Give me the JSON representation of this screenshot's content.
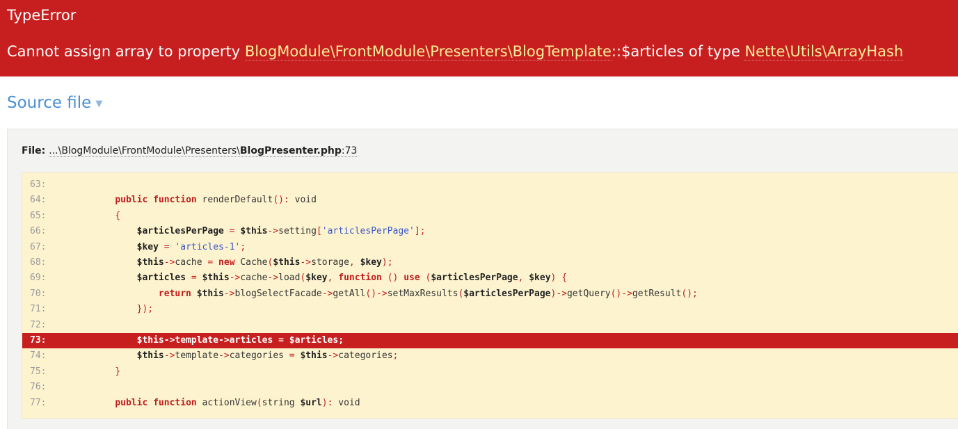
{
  "header": {
    "type": "TypeError",
    "message": {
      "prefix": "Cannot assign array to property",
      "class": "BlogModule\\FrontModule\\Presenters\\BlogTemplate",
      "sep": "::",
      "property": "$articles of type",
      "type": "Nette\\Utils\\ArrayHash"
    }
  },
  "section": {
    "title": "Source file",
    "toggle_icon": "triangle-down-icon"
  },
  "file": {
    "label": "File:",
    "path": "...\\BlogModule\\FrontModule\\Presenters\\",
    "name": "BlogPresenter.php",
    "line": ":73"
  },
  "code": {
    "active_line": 73,
    "lines": [
      {
        "no": "63:",
        "tokens": []
      },
      {
        "no": "64:",
        "tokens": [
          [
            "    ",
            "pl"
          ],
          [
            "public",
            "kw"
          ],
          [
            " ",
            "pl"
          ],
          [
            "function",
            "kw"
          ],
          [
            " renderDefault",
            "pl"
          ],
          [
            "():",
            "op"
          ],
          [
            " void",
            "pl"
          ]
        ]
      },
      {
        "no": "65:",
        "tokens": [
          [
            "    ",
            "pl"
          ],
          [
            "{",
            "op"
          ]
        ]
      },
      {
        "no": "66:",
        "tokens": [
          [
            "        ",
            "pl"
          ],
          [
            "$articlesPerPage",
            "var"
          ],
          [
            " = ",
            "op"
          ],
          [
            "$this",
            "var"
          ],
          [
            "->",
            "op"
          ],
          [
            "setting",
            "pl"
          ],
          [
            "[",
            "op"
          ],
          [
            "'articlesPerPage'",
            "str"
          ],
          [
            "];",
            "op"
          ]
        ]
      },
      {
        "no": "67:",
        "tokens": [
          [
            "        ",
            "pl"
          ],
          [
            "$key",
            "var"
          ],
          [
            " = ",
            "op"
          ],
          [
            "'articles-1'",
            "str"
          ],
          [
            ";",
            "op"
          ]
        ]
      },
      {
        "no": "68:",
        "tokens": [
          [
            "        ",
            "pl"
          ],
          [
            "$this",
            "var"
          ],
          [
            "->",
            "op"
          ],
          [
            "cache",
            "pl"
          ],
          [
            " = ",
            "op"
          ],
          [
            "new",
            "kw"
          ],
          [
            " Cache",
            "pl"
          ],
          [
            "(",
            "op"
          ],
          [
            "$this",
            "var"
          ],
          [
            "->",
            "op"
          ],
          [
            "storage",
            "pl"
          ],
          [
            ", ",
            "op"
          ],
          [
            "$key",
            "var"
          ],
          [
            ");",
            "op"
          ]
        ]
      },
      {
        "no": "69:",
        "tokens": [
          [
            "        ",
            "pl"
          ],
          [
            "$articles",
            "var"
          ],
          [
            " = ",
            "op"
          ],
          [
            "$this",
            "var"
          ],
          [
            "->",
            "op"
          ],
          [
            "cache",
            "pl"
          ],
          [
            "->",
            "op"
          ],
          [
            "load",
            "pl"
          ],
          [
            "(",
            "op"
          ],
          [
            "$key",
            "var"
          ],
          [
            ", ",
            "op"
          ],
          [
            "function",
            "kw"
          ],
          [
            " () ",
            "op"
          ],
          [
            "use",
            "kw"
          ],
          [
            " (",
            "op"
          ],
          [
            "$articlesPerPage",
            "var"
          ],
          [
            ", ",
            "op"
          ],
          [
            "$key",
            "var"
          ],
          [
            ") {",
            "op"
          ]
        ]
      },
      {
        "no": "70:",
        "tokens": [
          [
            "            ",
            "pl"
          ],
          [
            "return",
            "kw"
          ],
          [
            " ",
            "pl"
          ],
          [
            "$this",
            "var"
          ],
          [
            "->",
            "op"
          ],
          [
            "blogSelectFacade",
            "pl"
          ],
          [
            "->",
            "op"
          ],
          [
            "getAll",
            "pl"
          ],
          [
            "()->",
            "op"
          ],
          [
            "setMaxResults",
            "pl"
          ],
          [
            "(",
            "op"
          ],
          [
            "$articlesPerPage",
            "var"
          ],
          [
            ")->",
            "op"
          ],
          [
            "getQuery",
            "pl"
          ],
          [
            "()->",
            "op"
          ],
          [
            "getResult",
            "pl"
          ],
          [
            "();",
            "op"
          ]
        ]
      },
      {
        "no": "71:",
        "tokens": [
          [
            "        ",
            "pl"
          ],
          [
            "});",
            "op"
          ]
        ]
      },
      {
        "no": "72:",
        "tokens": []
      },
      {
        "no": "73:",
        "tokens": [
          [
            "        $this->template->articles = $articles;",
            "pl"
          ]
        ]
      },
      {
        "no": "74:",
        "tokens": [
          [
            "        ",
            "pl"
          ],
          [
            "$this",
            "var"
          ],
          [
            "->",
            "op"
          ],
          [
            "template",
            "pl"
          ],
          [
            "->",
            "op"
          ],
          [
            "categories",
            "pl"
          ],
          [
            " = ",
            "op"
          ],
          [
            "$this",
            "var"
          ],
          [
            "->",
            "op"
          ],
          [
            "categories",
            "pl"
          ],
          [
            ";",
            "op"
          ]
        ]
      },
      {
        "no": "75:",
        "tokens": [
          [
            "    ",
            "pl"
          ],
          [
            "}",
            "op"
          ]
        ]
      },
      {
        "no": "76:",
        "tokens": []
      },
      {
        "no": "77:",
        "tokens": [
          [
            "    ",
            "pl"
          ],
          [
            "public",
            "kw"
          ],
          [
            " ",
            "pl"
          ],
          [
            "function",
            "kw"
          ],
          [
            " actionView",
            "pl"
          ],
          [
            "(",
            "op"
          ],
          [
            "string ",
            "pl"
          ],
          [
            "$url",
            "var"
          ],
          [
            "):",
            "op"
          ],
          [
            " void",
            "pl"
          ]
        ]
      }
    ]
  }
}
